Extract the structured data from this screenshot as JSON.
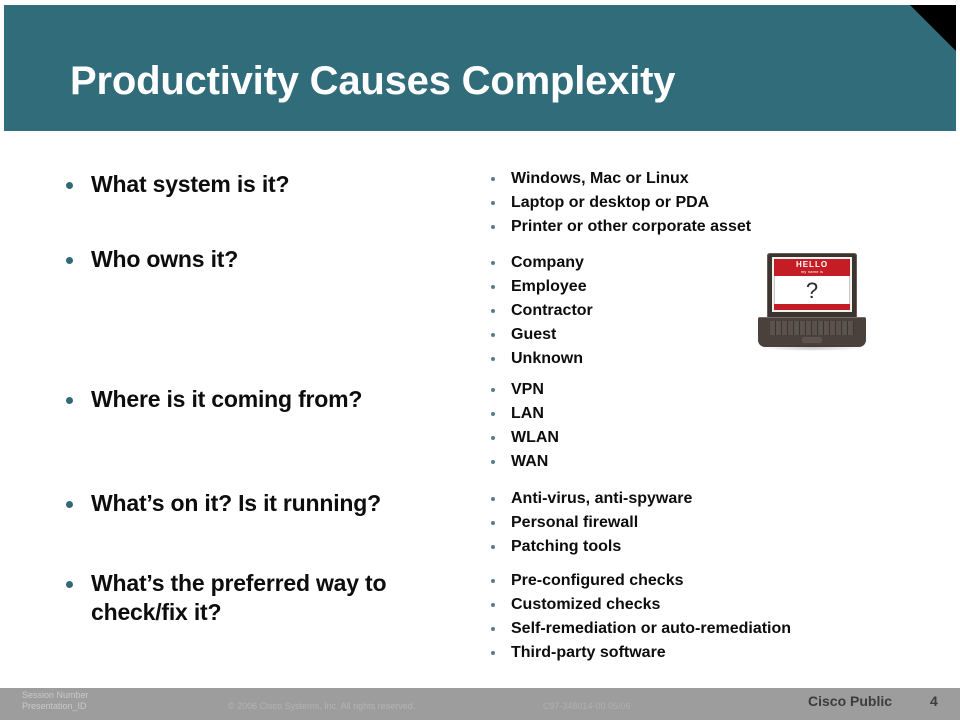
{
  "slide": {
    "title": "Productivity Causes Complexity",
    "accent_color": "#316c7a",
    "bullet_color": "#2f6b77",
    "corner_color": "#000000"
  },
  "questions": [
    {
      "label": "What system is it?"
    },
    {
      "label": "Who owns it?"
    },
    {
      "label": "Where is it coming from?"
    },
    {
      "label": "What’s on it? Is it running?"
    },
    {
      "label": "What’s the preferred way to check/fix it?"
    }
  ],
  "answer_groups": [
    {
      "items": [
        "Windows, Mac or Linux",
        "Laptop or desktop or PDA",
        "Printer or other corporate asset"
      ]
    },
    {
      "items": [
        "Company",
        "Employee",
        "Contractor",
        "Guest",
        "Unknown"
      ]
    },
    {
      "items": [
        "VPN",
        "LAN",
        "WLAN",
        "WAN"
      ]
    },
    {
      "items": [
        "Anti-virus, anti-spyware",
        "Personal firewall",
        "Patching tools"
      ]
    },
    {
      "items": [
        "Pre-configured checks",
        "Customized checks",
        "Self-remediation or auto-remediation",
        "Third-party software"
      ]
    }
  ],
  "laptop_image": {
    "tag_hello": "HELLO",
    "tag_sub": "my name is",
    "tag_question": "?",
    "tag_color": "#c41d26"
  },
  "footer": {
    "session_number": "Session Number",
    "presentation_id": "Presentation_ID",
    "copyright": "© 2006 Cisco Systems, Inc. All rights reserved.",
    "doc_id": "C97-348014-00   05/06",
    "classification": "Cisco Public",
    "page_number": "4"
  }
}
